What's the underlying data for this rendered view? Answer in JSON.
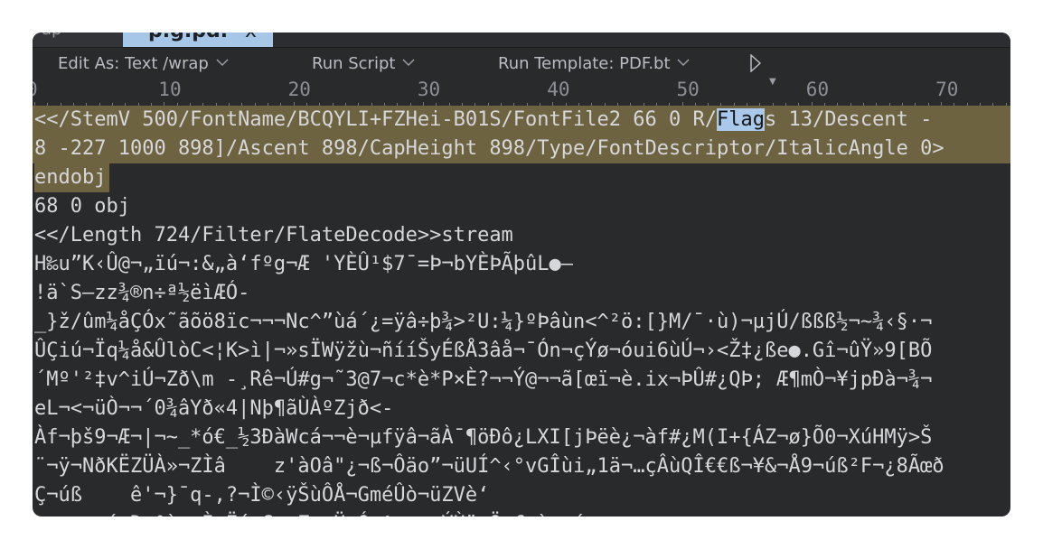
{
  "tabs": [
    {
      "label": "ap",
      "active": false
    },
    {
      "label": "p.g.pd.",
      "active": true,
      "close": "x"
    }
  ],
  "toolbar": {
    "edit_as": "Edit As: Text /wrap",
    "run_script": "Run Script",
    "run_template": "Run Template: PDF.bt",
    "run_icon": "play-icon"
  },
  "ruler": {
    "labels": [
      "0",
      "10",
      "20",
      "30",
      "40",
      "50",
      "60",
      "70"
    ]
  },
  "editor": {
    "selection_color": "#6e6340",
    "highlight_color": "#aac8ea",
    "lines": [
      {
        "segments": [
          {
            "text": "<</StemV 500/FontName/BCQYLI+FZHei-B01S/FontFile2 66 0 R/"
          },
          {
            "text": "Flag",
            "highlight": true
          },
          {
            "text": "s 13/Descent -"
          }
        ],
        "selected": true
      },
      {
        "segments": [
          {
            "text": "8 -227 1000 898]/Ascent 898/CapHeight 898/Type/FontDescriptor/ItalicAngle 0>"
          }
        ],
        "selected": true
      },
      {
        "segments": [
          {
            "text": "endobj"
          }
        ],
        "selected": true,
        "partial": true
      },
      {
        "segments": [
          {
            "text": "68 0 obj"
          }
        ]
      },
      {
        "segments": [
          {
            "text": "<</Length 724/Filter/FlateDecode>>stream"
          }
        ]
      },
      {
        "segments": [
          {
            "text": "H‰u”K‹Û@¬„ïú¬:&„à‘fºg¬Æ 'YÈÛ¹$7¯=Þ¬bYÈÞÃþûL●–"
          }
        ]
      },
      {
        "segments": [
          {
            "text": "!ä`S–zz¾®n÷ª½ëìÆÓ-"
          }
        ]
      },
      {
        "segments": [
          {
            "text": "_}ž/ûm¼åÇÓx˜ãõö8ïc¬¬¬Nc^”ùá´¿=ÿâ÷þ¾>²U:¼}ºÞâùn<^²ö:[}M/¯·ù)¬µjÚ/ßßß½¬~¾‹§·¬"
          }
        ]
      },
      {
        "segments": [
          {
            "text": "ÛÇiú¬Ïq¼å&ÛlòC<¦K>ì|¬»sÏWÿžù¬ñííŠyÉßÅ3âå¬¯Ón¬çÝø¬óui6ùÚ¬›<Ž‡¿ße●.Gî¬ûŸ»9[BÕ"
          }
        ]
      },
      {
        "segments": [
          {
            "text": "´Mº'²‡v^iÚ¬Zð\\m -¸Rê¬Ú#g¬˜3@7¬c*è*P×È?¬¬Ý@¬¬ã[œï¬è.ix¬ÞÛ#¿QÞ; Æ¶mÒ¬¥jpÐà¬¾¬"
          }
        ]
      },
      {
        "segments": [
          {
            "text": "eL¬<¬üÒ¬¬´0¾âYð«4|Nþ¶ãÙÀºZjð<-"
          }
        ]
      },
      {
        "segments": [
          {
            "text": "Àf¬þš9¬Æ¬|¬~_*ó€_½3ÐàWcá¬¬è¬µfÿâ¬ãÀ¯¶öÐô¿LXI[jÞëè¿¬àf#¿M(I+{ÁZ¬ø}Õ0¬XúHMÿ>Š"
          }
        ]
      },
      {
        "segments": [
          {
            "text": "¨¬ÿ¬NðKËZÜÀ»¬ZÌâ    z'àOâ\"¿¬ß¬Ôäo”¬üUÍ^‹°vGÎùi„1ä¬…çÂùQÎ€€ß¬¥&¬Å9¬úß²F¬¿8Ãœð"
          }
        ]
      },
      {
        "segments": [
          {
            "text": "Ç¬úß    ê'¬}¯q-,?¬Ì©‹ÿŠùÔÅ¬GméÛò¬üZVè‘"
          }
        ]
      },
      {
        "segments": [
          {
            "text": "·¬µ¬  ´¬Ð¬°`¸~Ì¬Ë´¬G©¬Z‹¬Ü,Ó¬^¬¬µ¬ÝÙü¬Ö¬£¬`¬¸´"
          }
        ]
      }
    ]
  }
}
